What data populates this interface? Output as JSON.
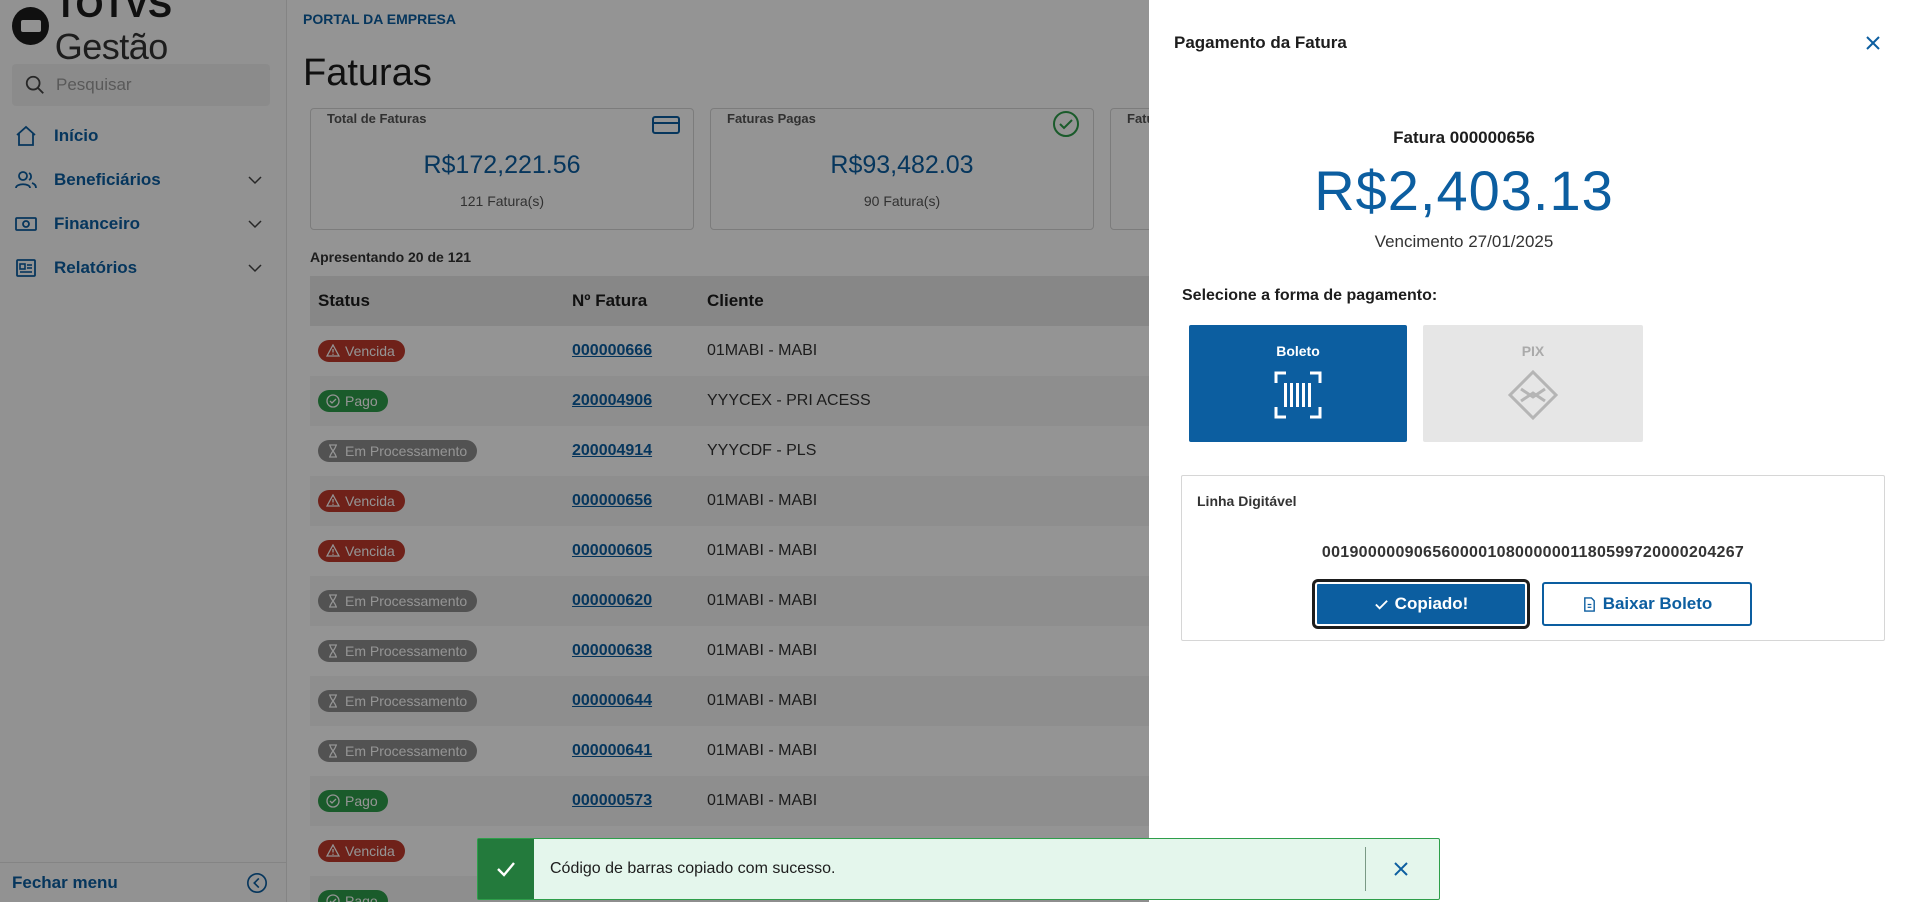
{
  "app": {
    "logo_bold": "TOTVS",
    "logo_light": "Gestão"
  },
  "sidebar": {
    "search_placeholder": "Pesquisar",
    "items": [
      {
        "label": "Início",
        "icon": "home-icon"
      },
      {
        "label": "Beneficiários",
        "icon": "users-icon"
      },
      {
        "label": "Financeiro",
        "icon": "money-icon"
      },
      {
        "label": "Relatórios",
        "icon": "report-icon"
      }
    ],
    "footer_label": "Fechar menu"
  },
  "main": {
    "breadcrumb": "PORTAL DA EMPRESA",
    "title": "Faturas",
    "cards": [
      {
        "title": "Total de Faturas",
        "value": "R$172,221.56",
        "sub": "121 Fatura(s)"
      },
      {
        "title": "Faturas Pagas",
        "value": "R$93,482.03",
        "sub": "90 Fatura(s)"
      },
      {
        "title": "Fatu",
        "value": "",
        "sub": ""
      }
    ],
    "count_text": "Apresentando 20 de 121",
    "table": {
      "headers": [
        "Status",
        "Nº Fatura",
        "Cliente"
      ],
      "rows": [
        {
          "status": "Vencida",
          "type": "vencida",
          "number": "000000666",
          "client": "01MABI - MABI"
        },
        {
          "status": "Pago",
          "type": "pago",
          "number": "200004906",
          "client": "YYYCEX - PRI ACESS"
        },
        {
          "status": "Em Processamento",
          "type": "proc",
          "number": "200004914",
          "client": "YYYCDF - PLS"
        },
        {
          "status": "Vencida",
          "type": "vencida",
          "number": "000000656",
          "client": "01MABI - MABI"
        },
        {
          "status": "Vencida",
          "type": "vencida",
          "number": "000000605",
          "client": "01MABI - MABI"
        },
        {
          "status": "Em Processamento",
          "type": "proc",
          "number": "000000620",
          "client": "01MABI - MABI"
        },
        {
          "status": "Em Processamento",
          "type": "proc",
          "number": "000000638",
          "client": "01MABI - MABI"
        },
        {
          "status": "Em Processamento",
          "type": "proc",
          "number": "000000644",
          "client": "01MABI - MABI"
        },
        {
          "status": "Em Processamento",
          "type": "proc",
          "number": "000000641",
          "client": "01MABI - MABI"
        },
        {
          "status": "Pago",
          "type": "pago",
          "number": "000000573",
          "client": "01MABI - MABI"
        },
        {
          "status": "Vencida",
          "type": "vencida",
          "number": "",
          "client": ""
        },
        {
          "status": "Pago",
          "type": "pago",
          "number": "",
          "client": ""
        }
      ]
    }
  },
  "drawer": {
    "title": "Pagamento da Fatura",
    "fatura_label": "Fatura 000000656",
    "amount": "R$2,403.13",
    "due": "Vencimento 27/01/2025",
    "select_label": "Selecione a forma de pagamento:",
    "options": [
      {
        "label": "Boleto",
        "icon": "barcode-icon",
        "selected": true
      },
      {
        "label": "PIX",
        "icon": "pix-icon",
        "selected": false
      }
    ],
    "linha_label": "Linha Digitável",
    "linha_code": "00190000090656000010800000011805997200002O4267",
    "copy_button": "Copiado!",
    "download_button": "Baixar Boleto"
  },
  "toast": {
    "message": "Código de barras copiado com sucesso."
  },
  "colors": {
    "primary": "#0c5ea0",
    "vencida": "#c0392b",
    "pago": "#2e9e4a",
    "processamento": "#8e8e8e",
    "toast_bg": "#e4f6ec"
  }
}
